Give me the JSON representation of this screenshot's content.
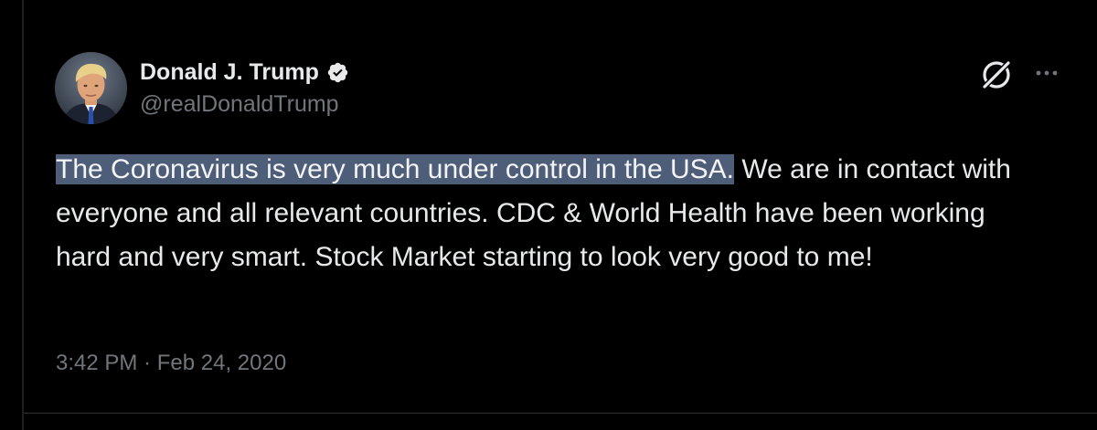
{
  "author": {
    "display_name": "Donald J. Trump",
    "handle": "@realDonaldTrump",
    "verified": true
  },
  "tweet": {
    "highlighted_text": "The Coronavirus is very much under control in the USA.",
    "rest_text": " We are in contact with everyone and all relevant countries. CDC & World Health have been working hard and very smart. Stock Market starting to look very good to me!",
    "time": "3:42 PM",
    "separator": " · ",
    "date": "Feb 24, 2020"
  },
  "icons": {
    "verified": "verified-badge-icon",
    "grok": "grok-icon",
    "more": "more-options-icon"
  },
  "colors": {
    "background": "#000000",
    "text": "#e7e9ea",
    "secondary": "#71767b",
    "highlight": "#4e5d78"
  }
}
